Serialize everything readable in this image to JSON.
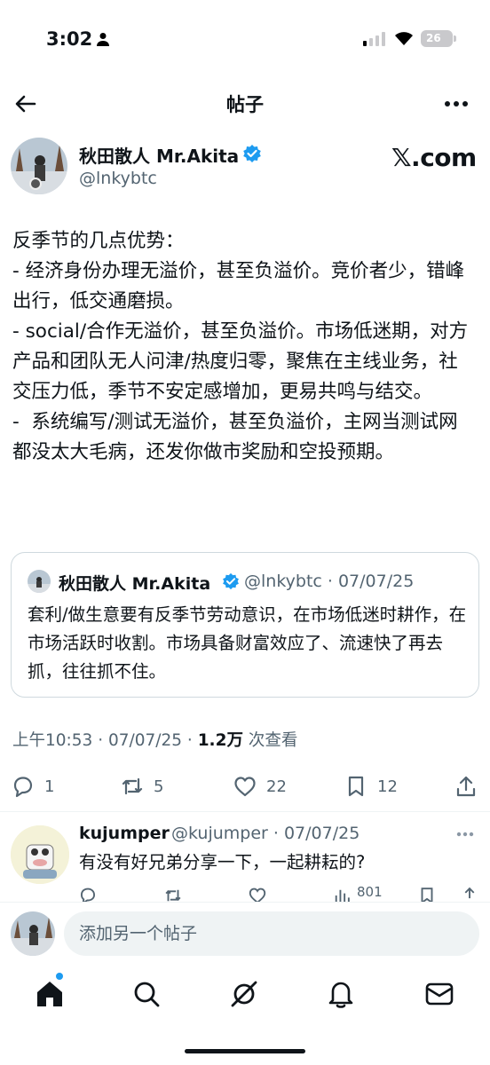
{
  "status_bar": {
    "time": "3:02",
    "battery": "26"
  },
  "header": {
    "title": "帖子"
  },
  "post": {
    "author_name": "秋田散人 Mr.Akita",
    "author_handle": "@lnkybtc",
    "source_logo": "𝕏.com",
    "body": "反季节的几点优势：\n- 经济身份办理无溢价，甚至负溢价。竞价者少，错峰出行，低交通磨损。\n- social/合作无溢价，甚至负溢价。市场低迷期，对方产品和团队无人问津/热度归零，聚焦在主线业务，社交压力低，季节不安定感增加，更易共鸣与结交。\n-  系统编写/测试无溢价，甚至负溢价，主网当测试网都没太大毛病，还发你做市奖励和空投预期。",
    "quote": {
      "author_name": "秋田散人 Mr.Akita",
      "meta": "@lnkybtc · 07/07/25",
      "text": "套利/做生意要有反季节劳动意识，在市场低迷时耕作，在市场活跃时收割。市场具备财富效应了、流速快了再去抓，往往抓不住。"
    },
    "time_prefix": "上午10:53 · 07/07/25 · ",
    "views_count": "1.2万",
    "views_label": " 次查看",
    "stats": {
      "replies": "1",
      "reposts": "5",
      "likes": "22",
      "bookmarks": "12"
    }
  },
  "reply": {
    "author_name": "kujumper",
    "meta": "@kujumper · 07/07/25",
    "text": "有没有好兄弟分享一下，一起耕耘的?",
    "views": "801"
  },
  "compose": {
    "placeholder": "添加另一个帖子"
  },
  "colors": {
    "accent": "#1d9bf0",
    "text": "#0f1419",
    "secondary": "#536471",
    "border": "#cfd9de"
  }
}
